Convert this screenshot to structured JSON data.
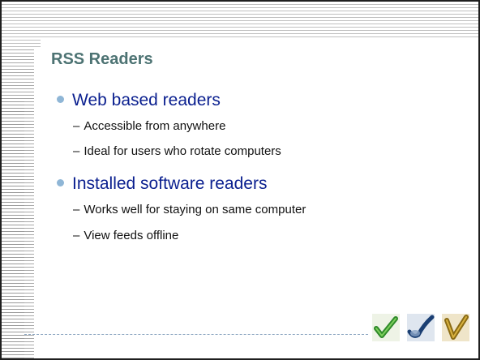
{
  "slide": {
    "title": "RSS Readers",
    "sections": [
      {
        "heading": "Web based readers",
        "items": [
          "Accessible from anywhere",
          "Ideal for users who rotate computers"
        ]
      },
      {
        "heading": "Installed software readers",
        "items": [
          "Works well for staying on same computer",
          "View feeds offline"
        ]
      }
    ],
    "dash": "–",
    "icons": [
      "green-checkmark-icon",
      "blue-checkmark-icon",
      "gold-checkmark-icon"
    ],
    "colors": {
      "title": "#4d7373",
      "heading": "#0a1f8f",
      "bullet": "#8fb6d6",
      "body_text": "#111111"
    }
  }
}
